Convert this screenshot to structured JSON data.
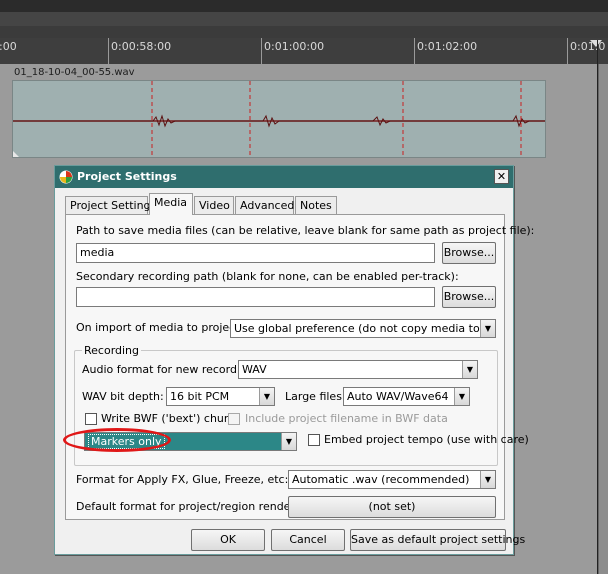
{
  "timeline": {
    "ticks": [
      ":00",
      "0:00:58:00",
      "0:01:00:00",
      "0:01:02:00",
      "0:01:0"
    ],
    "item_name": "01_18-10-04_00-55.wav"
  },
  "dialog": {
    "title": "Project Settings",
    "close_glyph": "✕",
    "tabs": [
      "Project Settings",
      "Media",
      "Video",
      "Advanced",
      "Notes"
    ],
    "active_tab": "Media",
    "media_path_label": "Path to save media files (can be relative, leave blank for same path as project file):",
    "media_path_value": "media",
    "browse_label": "Browse...",
    "secondary_path_label": "Secondary recording path (blank for none, can be enabled per-track):",
    "secondary_path_value": "",
    "browse2_label": "Browse...",
    "on_import_label": "On import of media to project:",
    "on_import_value": "Use global preference (do not copy media to project",
    "recording": {
      "group_title": "Recording",
      "audio_format_label": "Audio format for new recordings:",
      "audio_format_value": "WAV",
      "bit_depth_label": "WAV bit depth:",
      "bit_depth_value": "16 bit PCM",
      "large_files_label": "Large files:",
      "large_files_value": "Auto WAV/Wave64",
      "bwf_label": "Write BWF ('bext') chunk",
      "bwf_checked": false,
      "include_filename_label": "Include project filename in BWF data",
      "include_filename_checked": false,
      "markers_value": "Markers only",
      "embed_tempo_label": "Embed project tempo (use with care)",
      "embed_tempo_checked": false
    },
    "apply_fx_label": "Format for Apply FX, Glue, Freeze, etc:",
    "apply_fx_value": "Automatic .wav (recommended)",
    "default_render_label": "Default format for project/region render:",
    "default_render_value": "(not set)",
    "ok_label": "OK",
    "cancel_label": "Cancel",
    "save_default_label": "Save as default project settings"
  },
  "colors": {
    "title_bar": "#2f6e6e",
    "selection_teal": "#2c8787",
    "annotation_red": "#e01818",
    "waveform": "#7a1f1f"
  }
}
